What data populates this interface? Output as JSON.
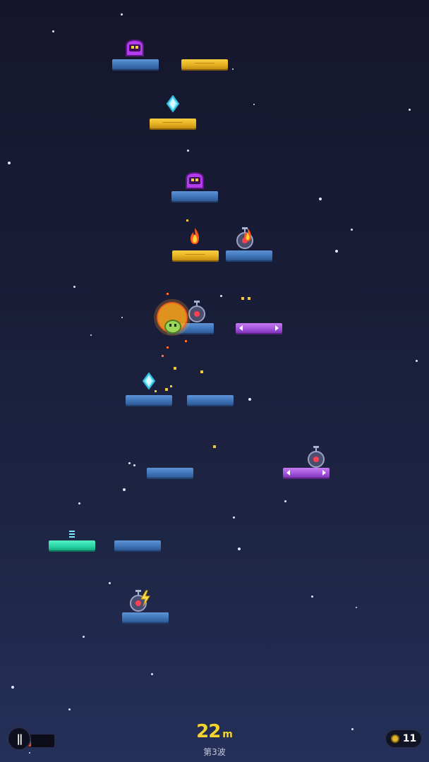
{
  "hud": {
    "distance_value": "22",
    "distance_unit": "m",
    "wave_label": "第3波",
    "coin_count": "11",
    "pause_glyph": "||",
    "health_fraction": 0.35
  },
  "colors": {
    "platform_blue": "#3f75b9",
    "platform_gold": "#e7b221",
    "platform_purple": "#a455dd",
    "platform_teal": "#2bd8a7",
    "distance_text": "#f5d42f",
    "health_fill": "#e8501f"
  },
  "entities": {
    "platforms": [
      {
        "type": "blue"
      },
      {
        "type": "gold"
      },
      {
        "type": "gold"
      },
      {
        "type": "blue"
      },
      {
        "type": "gold"
      },
      {
        "type": "blue"
      },
      {
        "type": "blue"
      },
      {
        "type": "purple-moving"
      },
      {
        "type": "blue"
      },
      {
        "type": "blue"
      },
      {
        "type": "blue"
      },
      {
        "type": "purple-moving"
      },
      {
        "type": "teal-spring"
      },
      {
        "type": "blue"
      },
      {
        "type": "blue"
      }
    ],
    "enemies": [
      "purple-slime",
      "purple-slime",
      "robot-drone",
      "robot-drone",
      "robot-drone",
      "robot-drone"
    ],
    "pickups": [
      "cyan-gem",
      "cyan-gem",
      "fire-orb"
    ],
    "player": "green-blob"
  }
}
